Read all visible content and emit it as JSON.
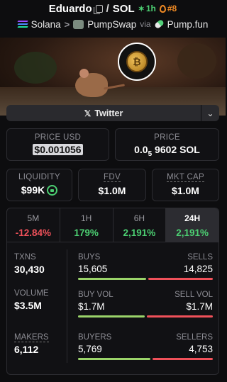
{
  "header": {
    "token_name": "Eduardo",
    "separator": "/",
    "quote": "SOL",
    "age": "1h",
    "rank": "#8",
    "chain": "Solana",
    "dex": "PumpSwap",
    "via": "via",
    "launchpad": "Pump.fun"
  },
  "social": {
    "twitter_label": "Twitter"
  },
  "price": {
    "usd_label": "PRICE USD",
    "usd_value": "$0.001056",
    "native_label": "PRICE",
    "native_prefix": "0.0",
    "native_zeros": "5",
    "native_digits": "9602 SOL"
  },
  "metrics": {
    "liquidity_label": "LIQUIDITY",
    "liquidity_value": "$99K",
    "fdv_label": "FDV",
    "fdv_value": "$1.0M",
    "mcap_label": "MKT CAP",
    "mcap_value": "$1.0M"
  },
  "timeframes": [
    {
      "label": "5M",
      "change": "-12.84%",
      "trend": "down"
    },
    {
      "label": "1H",
      "change": "179%",
      "trend": "up"
    },
    {
      "label": "6H",
      "change": "2,191%",
      "trend": "up"
    },
    {
      "label": "24H",
      "change": "2,191%",
      "trend": "up",
      "active": true
    }
  ],
  "stats": {
    "txns_label": "TXNS",
    "txns_value": "30,430",
    "volume_label": "VOLUME",
    "volume_value": "$3.5M",
    "makers_label": "MAKERS",
    "makers_value": "6,112",
    "buys_label": "BUYS",
    "buys_value": "15,605",
    "sells_label": "SELLS",
    "sells_value": "14,825",
    "buyvol_label": "BUY VOL",
    "buyvol_value": "$1.7M",
    "sellvol_label": "SELL VOL",
    "sellvol_value": "$1.7M",
    "buyers_label": "BUYERS",
    "buyers_value": "5,769",
    "sellers_label": "SELLERS",
    "sellers_value": "4,753",
    "buys_share": 0.513,
    "buyvol_share": 0.5,
    "buyers_share": 0.548
  },
  "colors": {
    "accent_green": "#4ccf72",
    "accent_red": "#f0515a",
    "rank_orange": "#f08a24",
    "bar_green": "#9bd46a"
  }
}
